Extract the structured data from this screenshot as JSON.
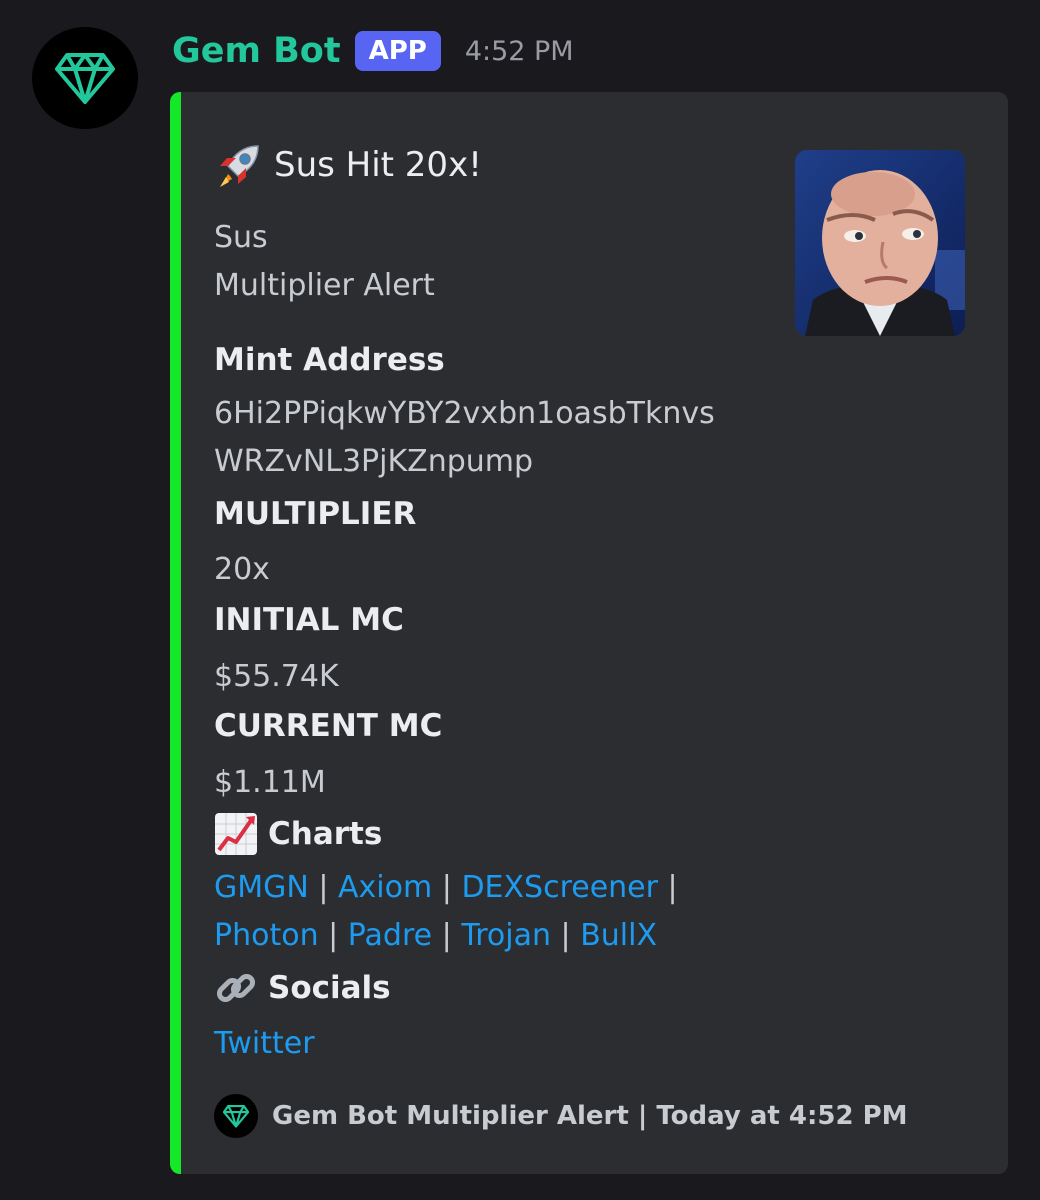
{
  "message": {
    "username": "Gem Bot",
    "badge": "APP",
    "timestamp": "4:52 PM"
  },
  "embed": {
    "accent_color": "#14e829",
    "title": "Sus Hit 20x!",
    "title_icon": "rocket-icon",
    "description": [
      "Sus",
      "Multiplier Alert"
    ],
    "fields": [
      {
        "name": "Mint Address",
        "value": [
          "6Hi2PPiqkwYBY2vxbn1oasbTknvs",
          "WRZvNL3PjKZnpump"
        ]
      },
      {
        "name": "MULTIPLIER",
        "value": "20x"
      },
      {
        "name": "INITIAL MC",
        "value": "$55.74K"
      },
      {
        "name": "CURRENT MC",
        "value": "$1.11M"
      }
    ],
    "charts": {
      "label": "Charts",
      "icon": "chart-increasing-icon",
      "links": [
        "GMGN",
        "Axiom",
        "DEXScreener",
        "Photon",
        "Padre",
        "Trojan",
        "BullX"
      ],
      "separator": "|"
    },
    "socials": {
      "label": "Socials",
      "icon": "link-icon",
      "links": [
        "Twitter"
      ]
    },
    "footer": "Gem Bot Multiplier Alert | Today at 4:52 PM"
  },
  "colors": {
    "username": "#23c79c",
    "badge": "#5865f2",
    "link": "#1d9bf0",
    "embed_bg": "#2b2d31",
    "page_bg": "#1a1a1e"
  }
}
